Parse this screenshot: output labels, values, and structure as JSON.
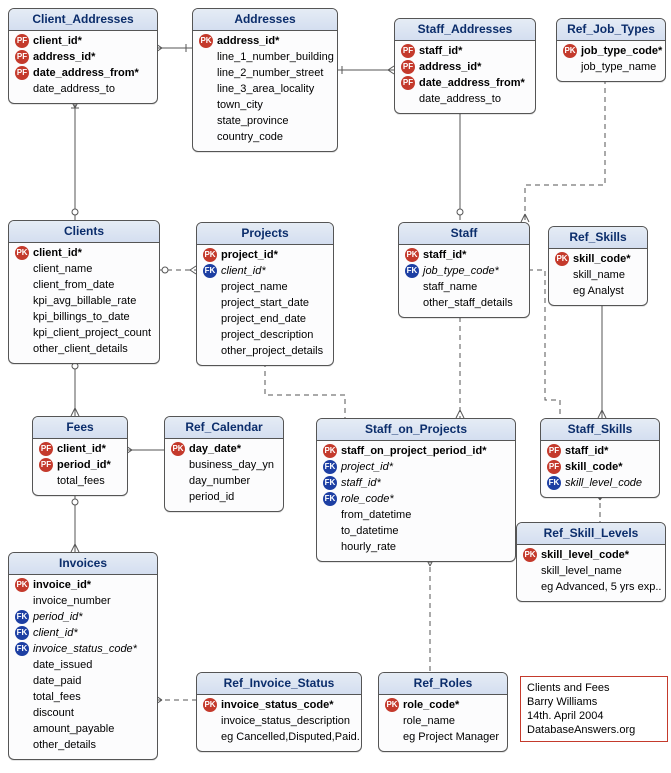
{
  "caption": {
    "line1": "Clients and Fees",
    "line2": "Barry Williams",
    "line3": "14th. April 2004",
    "line4": "DatabaseAnswers.org"
  },
  "entities": {
    "client_addresses": {
      "title": "Client_Addresses",
      "attrs": [
        {
          "key": "PF",
          "name": "client_id*",
          "bold": true
        },
        {
          "key": "PF",
          "name": "address_id*",
          "bold": true
        },
        {
          "key": "PF",
          "name": "date_address_from*",
          "bold": true
        },
        {
          "key": "",
          "name": "date_address_to"
        }
      ]
    },
    "addresses": {
      "title": "Addresses",
      "attrs": [
        {
          "key": "PK",
          "name": "address_id*",
          "bold": true
        },
        {
          "key": "",
          "name": "line_1_number_building"
        },
        {
          "key": "",
          "name": "line_2_number_street"
        },
        {
          "key": "",
          "name": "line_3_area_locality"
        },
        {
          "key": "",
          "name": "town_city"
        },
        {
          "key": "",
          "name": "state_province"
        },
        {
          "key": "",
          "name": "country_code"
        }
      ]
    },
    "staff_addresses": {
      "title": "Staff_Addresses",
      "attrs": [
        {
          "key": "PF",
          "name": "staff_id*",
          "bold": true
        },
        {
          "key": "PF",
          "name": "address_id*",
          "bold": true
        },
        {
          "key": "PF",
          "name": "date_address_from*",
          "bold": true
        },
        {
          "key": "",
          "name": "date_address_to"
        }
      ]
    },
    "ref_job_types": {
      "title": "Ref_Job_Types",
      "attrs": [
        {
          "key": "PK",
          "name": "job_type_code*",
          "bold": true
        },
        {
          "key": "",
          "name": "job_type_name"
        }
      ]
    },
    "clients": {
      "title": "Clients",
      "attrs": [
        {
          "key": "PK",
          "name": "client_id*",
          "bold": true
        },
        {
          "key": "",
          "name": "client_name"
        },
        {
          "key": "",
          "name": "client_from_date"
        },
        {
          "key": "",
          "name": "kpi_avg_billable_rate"
        },
        {
          "key": "",
          "name": "kpi_billings_to_date"
        },
        {
          "key": "",
          "name": "kpi_client_project_count"
        },
        {
          "key": "",
          "name": "other_client_details"
        }
      ]
    },
    "projects": {
      "title": "Projects",
      "attrs": [
        {
          "key": "PK",
          "name": "project_id*",
          "bold": true
        },
        {
          "key": "FK",
          "name": "client_id*",
          "italic": true
        },
        {
          "key": "",
          "name": "project_name"
        },
        {
          "key": "",
          "name": "project_start_date"
        },
        {
          "key": "",
          "name": "project_end_date"
        },
        {
          "key": "",
          "name": "project_description"
        },
        {
          "key": "",
          "name": "other_project_details"
        }
      ]
    },
    "staff": {
      "title": "Staff",
      "attrs": [
        {
          "key": "PK",
          "name": "staff_id*",
          "bold": true
        },
        {
          "key": "FK",
          "name": "job_type_code*",
          "italic": true
        },
        {
          "key": "",
          "name": "staff_name"
        },
        {
          "key": "",
          "name": "other_staff_details"
        }
      ]
    },
    "ref_skills": {
      "title": "Ref_Skills",
      "attrs": [
        {
          "key": "PK",
          "name": "skill_code*",
          "bold": true
        },
        {
          "key": "",
          "name": "skill_name"
        },
        {
          "key": "",
          "name": "eg Analyst"
        }
      ]
    },
    "fees": {
      "title": "Fees",
      "attrs": [
        {
          "key": "PF",
          "name": "client_id*",
          "bold": true
        },
        {
          "key": "PF",
          "name": "period_id*",
          "bold": true
        },
        {
          "key": "",
          "name": "total_fees"
        }
      ]
    },
    "ref_calendar": {
      "title": "Ref_Calendar",
      "attrs": [
        {
          "key": "PK",
          "name": "day_date*",
          "bold": true
        },
        {
          "key": "",
          "name": "business_day_yn"
        },
        {
          "key": "",
          "name": "day_number"
        },
        {
          "key": "",
          "name": "period_id"
        }
      ]
    },
    "staff_on_projects": {
      "title": "Staff_on_Projects",
      "attrs": [
        {
          "key": "PK",
          "name": "staff_on_project_period_id*",
          "bold": true
        },
        {
          "key": "FK",
          "name": "project_id*",
          "italic": true
        },
        {
          "key": "FK",
          "name": "staff_id*",
          "italic": true
        },
        {
          "key": "FK",
          "name": "role_code*",
          "italic": true
        },
        {
          "key": "",
          "name": "from_datetime"
        },
        {
          "key": "",
          "name": "to_datetime"
        },
        {
          "key": "",
          "name": "hourly_rate"
        }
      ]
    },
    "staff_skills": {
      "title": "Staff_Skills",
      "attrs": [
        {
          "key": "PF",
          "name": "staff_id*",
          "bold": true
        },
        {
          "key": "PF",
          "name": "skill_code*",
          "bold": true
        },
        {
          "key": "FK",
          "name": "skill_level_code",
          "italic": true
        }
      ]
    },
    "ref_skill_levels": {
      "title": "Ref_Skill_Levels",
      "attrs": [
        {
          "key": "PK",
          "name": "skill_level_code*",
          "bold": true
        },
        {
          "key": "",
          "name": "skill_level_name"
        },
        {
          "key": "",
          "name": "eg Advanced, 5 yrs exp.."
        }
      ]
    },
    "invoices": {
      "title": "Invoices",
      "attrs": [
        {
          "key": "PK",
          "name": "invoice_id*",
          "bold": true
        },
        {
          "key": "",
          "name": "invoice_number"
        },
        {
          "key": "FK",
          "name": "period_id*",
          "italic": true
        },
        {
          "key": "FK",
          "name": "client_id*",
          "italic": true
        },
        {
          "key": "FK",
          "name": "invoice_status_code*",
          "italic": true
        },
        {
          "key": "",
          "name": "date_issued"
        },
        {
          "key": "",
          "name": "date_paid"
        },
        {
          "key": "",
          "name": "total_fees"
        },
        {
          "key": "",
          "name": "discount"
        },
        {
          "key": "",
          "name": "amount_payable"
        },
        {
          "key": "",
          "name": "other_details"
        }
      ]
    },
    "ref_invoice_status": {
      "title": "Ref_Invoice_Status",
      "attrs": [
        {
          "key": "PK",
          "name": "invoice_status_code*",
          "bold": true
        },
        {
          "key": "",
          "name": "invoice_status_description"
        },
        {
          "key": "",
          "name": "eg Cancelled,Disputed,Paid."
        }
      ]
    },
    "ref_roles": {
      "title": "Ref_Roles",
      "attrs": [
        {
          "key": "PK",
          "name": "role_code*",
          "bold": true
        },
        {
          "key": "",
          "name": "role_name"
        },
        {
          "key": "",
          "name": "eg Project Manager"
        }
      ]
    }
  }
}
